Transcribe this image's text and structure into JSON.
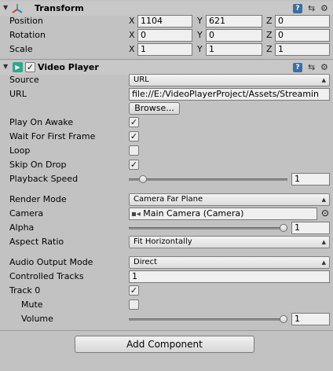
{
  "transform": {
    "title": "Transform",
    "position_label": "Position",
    "rotation_label": "Rotation",
    "scale_label": "Scale",
    "axis_x": "X",
    "axis_y": "Y",
    "axis_z": "Z",
    "position": {
      "x": "1104",
      "y": "621",
      "z": "0"
    },
    "rotation": {
      "x": "0",
      "y": "0",
      "z": "0"
    },
    "scale": {
      "x": "1",
      "y": "1",
      "z": "1"
    },
    "help_glyph": "?",
    "settings_glyph": "⚙"
  },
  "video_player": {
    "title": "Video Player",
    "enabled": true,
    "source_label": "Source",
    "source_value": "URL",
    "url_label": "URL",
    "url_value": "file://E:/VideoPlayerProject/Assets/Streamin",
    "browse_label": "Browse...",
    "play_on_awake_label": "Play On Awake",
    "wait_first_frame_label": "Wait For First Frame",
    "loop_label": "Loop",
    "skip_on_drop_label": "Skip On Drop",
    "playback_speed_label": "Playback Speed",
    "playback_speed_value": "1",
    "playback_speed_fraction": 0.07,
    "render_mode_label": "Render Mode",
    "render_mode_value": "Camera Far Plane",
    "camera_label": "Camera",
    "camera_value": "Main Camera (Camera)",
    "alpha_label": "Alpha",
    "alpha_value": "1",
    "alpha_fraction": 1.0,
    "aspect_ratio_label": "Aspect Ratio",
    "aspect_ratio_value": "Fit Horizontally",
    "audio_output_label": "Audio Output Mode",
    "audio_output_value": "Direct",
    "controlled_tracks_label": "Controlled Tracks",
    "controlled_tracks_value": "1",
    "track0_label": "Track 0",
    "mute_label": "Mute",
    "volume_label": "Volume",
    "volume_value": "1",
    "volume_fraction": 1.0,
    "checks": {
      "play_on_awake": true,
      "wait_first_frame": true,
      "loop": false,
      "skip_on_drop": true,
      "track0": true,
      "mute": false
    },
    "check_glyph": "✓",
    "dropdown_glyph": "▲▼",
    "target_glyph": "⊙"
  },
  "add_component_label": "Add Component",
  "colors": {
    "background": "#c2c2c2",
    "header": "#c8c8c8",
    "accent_video": "#2fa88a",
    "help": "#3a6ea5"
  }
}
